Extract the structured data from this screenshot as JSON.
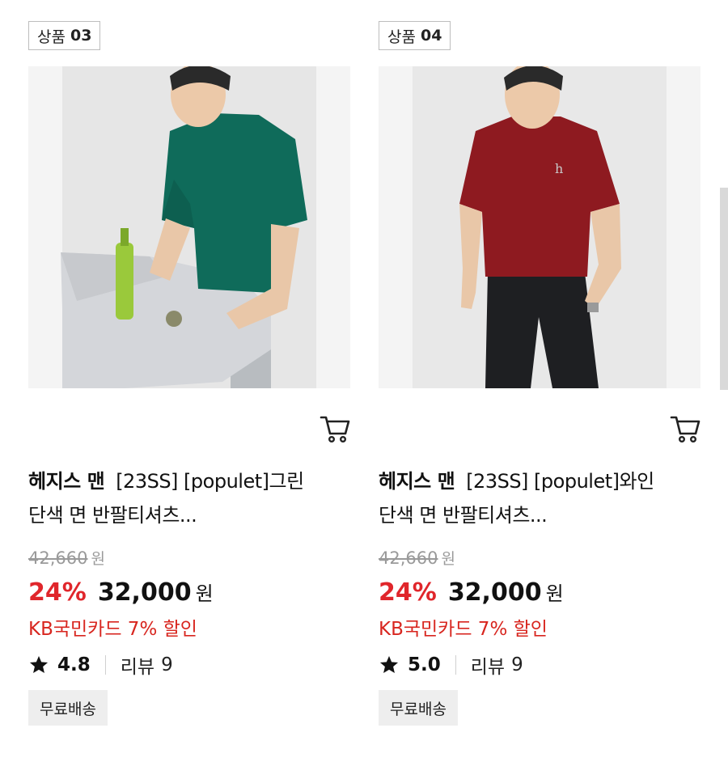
{
  "products": [
    {
      "tag_prefix": "상품",
      "tag_number": "03",
      "image_icon": "product-photo-green-tshirt",
      "shirt_color": "#0f6b5a",
      "brand": "헤지스 맨",
      "name_line1": "[23SS] [populet]그린",
      "name_line2": "단색 면 반팔티셔츠...",
      "original_price": "42,660",
      "original_currency": "원",
      "discount_rate": "24%",
      "sale_price": "32,000",
      "sale_currency": "원",
      "card_discount": "KB국민카드 7% 할인",
      "rating": "4.8",
      "review_label": "리뷰",
      "review_count": "9",
      "shipping_badge": "무료배송"
    },
    {
      "tag_prefix": "상품",
      "tag_number": "04",
      "image_icon": "product-photo-wine-tshirt",
      "shirt_color": "#8e1a20",
      "brand": "헤지스 맨",
      "name_line1": "[23SS] [populet]와인",
      "name_line2": "단색 면 반팔티셔츠...",
      "original_price": "42,660",
      "original_currency": "원",
      "discount_rate": "24%",
      "sale_price": "32,000",
      "sale_currency": "원",
      "card_discount": "KB국민카드 7% 할인",
      "rating": "5.0",
      "review_label": "리뷰",
      "review_count": "9",
      "shipping_badge": "무료배송"
    }
  ],
  "colors": {
    "discount_red": "#e0262b",
    "card_red": "#d8261f",
    "strike_gray": "#9a9a9a",
    "badge_bg": "#eeeeee"
  }
}
